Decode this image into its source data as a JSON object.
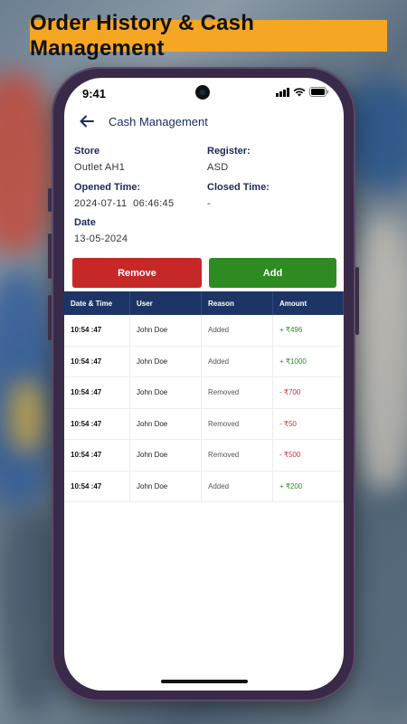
{
  "banner": "Order History & Cash Management",
  "status_bar": {
    "time": "9:41"
  },
  "appbar": {
    "title": "Cash Management",
    "back_icon": "arrow-left-icon"
  },
  "details": {
    "store_label": "Store",
    "store_value": "Outlet AH1",
    "register_label": "Register:",
    "register_value": "ASD",
    "opened_label": "Opened Time:",
    "opened_value": "2024-07-11  06:46:45",
    "closed_label": "Closed Time:",
    "closed_value": "-",
    "date_label": "Date",
    "date_value": "13-05-2024"
  },
  "actions": {
    "remove_label": "Remove",
    "add_label": "Add"
  },
  "table": {
    "headers": [
      "Date & Time",
      "User",
      "Reason",
      "Amount"
    ],
    "rows": [
      {
        "time": "10:54 :47",
        "user": "John Doe",
        "reason": "Added",
        "amount": "+ ₹496",
        "sign": "pos"
      },
      {
        "time": "10:54 :47",
        "user": "John Doe",
        "reason": "Added",
        "amount": "+ ₹1000",
        "sign": "pos"
      },
      {
        "time": "10:54 :47",
        "user": "John Doe",
        "reason": "Removed",
        "amount": "- ₹700",
        "sign": "neg"
      },
      {
        "time": "10:54 :47",
        "user": "John Doe",
        "reason": "Removed",
        "amount": "- ₹50",
        "sign": "neg"
      },
      {
        "time": "10:54 :47",
        "user": "John Doe",
        "reason": "Removed",
        "amount": "- ₹500",
        "sign": "neg"
      },
      {
        "time": "10:54 :47",
        "user": "John Doe",
        "reason": "Added",
        "amount": "+ ₹200",
        "sign": "pos"
      }
    ]
  },
  "colors": {
    "banner_bg": "#f5a623",
    "primary_navy": "#1d3566",
    "remove_red": "#c62828",
    "add_green": "#2e8b22"
  }
}
